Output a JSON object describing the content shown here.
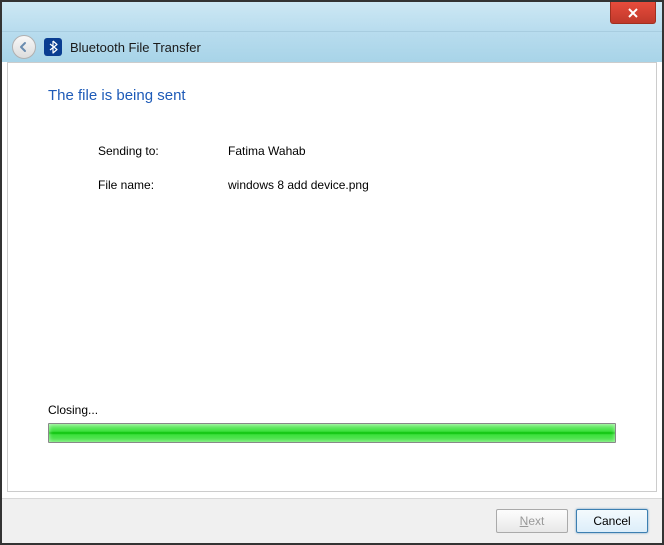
{
  "window": {
    "title": "Bluetooth File Transfer"
  },
  "heading": "The file is being sent",
  "fields": {
    "sending_to_label": "Sending to:",
    "sending_to_value": "Fatima Wahab",
    "file_name_label": "File name:",
    "file_name_value": "windows 8 add device.png"
  },
  "progress": {
    "status": "Closing...",
    "percent": 100
  },
  "buttons": {
    "next_prefix": "N",
    "next_rest": "ext",
    "cancel": "Cancel"
  }
}
